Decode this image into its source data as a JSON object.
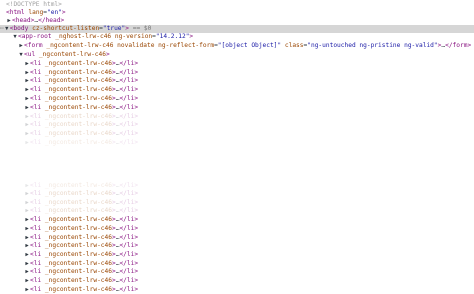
{
  "doctype": "<!DOCTYPE html>",
  "html_open": {
    "tag": "<html",
    "attr": "lang",
    "val": "\"en\"",
    "close": ">"
  },
  "head": {
    "open": "<head>",
    "ell": "…",
    "close": "</head>"
  },
  "body": {
    "tag": "<body",
    "attr": "cz-shortcut-listen",
    "val": "\"true\"",
    "close": ">",
    "marker": "== $0"
  },
  "app_root": {
    "tag": "<app-root",
    "attr1": "_nghost-lrw-c46",
    "attr2": "ng-version",
    "val2": "\"14.2.12\"",
    "close": ">"
  },
  "form": {
    "tag": "<form",
    "attr1": "_ngcontent-lrw-c46",
    "attr2": "novalidate",
    "attr3": "ng-reflect-form",
    "val3": "\"[object Object]\"",
    "attr4": "class",
    "val4": "\"ng-untouched ng-pristine ng-valid\"",
    "close": ">",
    "ell": "…",
    "end": "</form>"
  },
  "ul": {
    "tag": "<ul",
    "attr": "_ngcontent-lrw-c46",
    "close": ">"
  },
  "li": {
    "tag": "<li",
    "attr": "_ngcontent-lrw-c46",
    "close": ">",
    "ell": "…",
    "end": "</li>"
  }
}
